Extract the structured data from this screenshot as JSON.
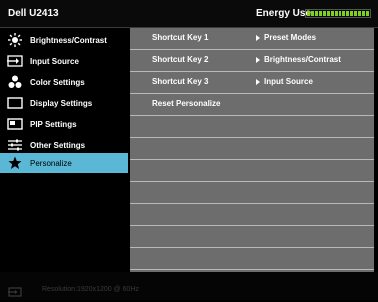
{
  "header": {
    "model": "Dell U2413",
    "energy_label": "Energy Use",
    "energy_level": 1.0
  },
  "sidebar": {
    "items": [
      {
        "label": "Brightness/Contrast",
        "icon": "brightness-icon"
      },
      {
        "label": "Input Source",
        "icon": "input-source-icon"
      },
      {
        "label": "Color Settings",
        "icon": "color-settings-icon"
      },
      {
        "label": "Display Settings",
        "icon": "display-settings-icon"
      },
      {
        "label": "PIP Settings",
        "icon": "pip-settings-icon"
      },
      {
        "label": "Other Settings",
        "icon": "other-settings-icon"
      },
      {
        "label": "Personalize",
        "icon": "star-icon",
        "active": true
      }
    ],
    "active_color": "#5ab8d6"
  },
  "panel": {
    "rows": [
      {
        "key": "Shortcut Key 1",
        "value": "Preset Modes"
      },
      {
        "key": "Shortcut Key 2",
        "value": "Brightness/Contrast"
      },
      {
        "key": "Shortcut Key 3",
        "value": "Input Source"
      },
      {
        "key": "Reset Personalize",
        "value": ""
      }
    ],
    "empty_rows": 7
  },
  "footer": {
    "resolution": "Resolution:1920x1200 @ 60Hz"
  }
}
